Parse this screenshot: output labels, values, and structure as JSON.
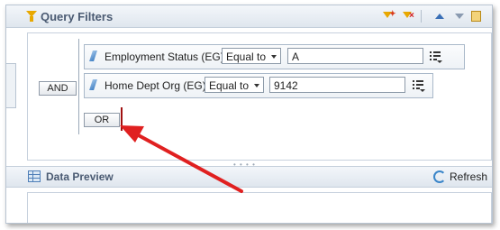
{
  "query_filters": {
    "title": "Query Filters",
    "icons": [
      "filter-icon",
      "add-filter-icon",
      "clear-filter-icon",
      "move-up-icon",
      "move-down-icon",
      "panel-icon"
    ]
  },
  "filters": {
    "and_label": "AND",
    "or_label": "OR",
    "rows": [
      {
        "object": "Employment Status (EG)",
        "operator": "Equal to",
        "value": "A"
      },
      {
        "object": "Home Dept Org (EG)",
        "operator": "Equal to",
        "value": "9142"
      }
    ]
  },
  "data_preview": {
    "title": "Data Preview",
    "refresh_label": "Refresh"
  },
  "annotation": {
    "arrow_color": "#e02020",
    "insertion_bar_color": "#a01010"
  }
}
